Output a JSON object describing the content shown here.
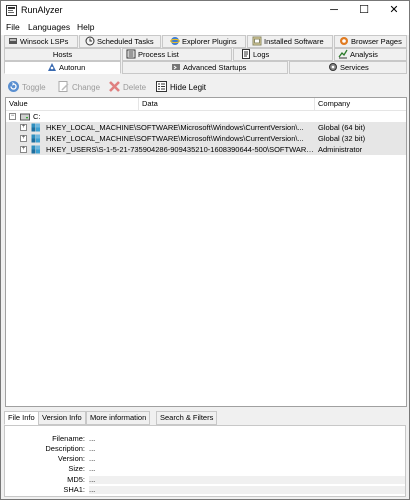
{
  "window": {
    "title": "RunAlyzer",
    "minimize": "─",
    "maximize": "☐",
    "close": "✕"
  },
  "menu": [
    "File",
    "Languages",
    "Help"
  ],
  "tabs_row1": [
    {
      "label": "Winsock LSPs",
      "icon": "winsock-icon"
    },
    {
      "label": "Scheduled Tasks",
      "icon": "clock-icon"
    },
    {
      "label": "Explorer Plugins",
      "icon": "explorer-icon"
    },
    {
      "label": "Installed Software",
      "icon": "software-icon"
    },
    {
      "label": "Browser Pages",
      "icon": "browser-icon"
    }
  ],
  "tabs_row2": [
    {
      "label": "Hosts",
      "icon": ""
    },
    {
      "label": "Process List",
      "icon": "process-icon"
    },
    {
      "label": "Logs",
      "icon": "logs-icon"
    },
    {
      "label": "Analysis",
      "icon": "analysis-icon"
    }
  ],
  "tabs_row3": [
    {
      "label": "Autorun",
      "icon": "autorun-icon",
      "active": true
    },
    {
      "label": "Advanced Startups",
      "icon": "advanced-icon"
    },
    {
      "label": "Services",
      "icon": "services-icon"
    }
  ],
  "toolbar": {
    "toggle": "Toggle",
    "change": "Change",
    "delete": "Delete",
    "hide_legit": "Hide Legit"
  },
  "grid": {
    "columns": [
      "Value",
      "Data",
      "Company"
    ],
    "root": "C:",
    "rows": [
      {
        "value": "HKEY_LOCAL_MACHINE\\SOFTWARE\\Microsoft\\Windows\\CurrentVersion\\...",
        "data": "",
        "company": "Global (64 bit)"
      },
      {
        "value": "HKEY_LOCAL_MACHINE\\SOFTWARE\\Microsoft\\Windows\\CurrentVersion\\...",
        "data": "",
        "company": "Global (32 bit)"
      },
      {
        "value": "HKEY_USERS\\S-1-5-21-735904286-909435210-1608390644-500\\SOFTWARE\\...",
        "data": "",
        "company": "Administrator"
      }
    ]
  },
  "bottom_tabs": [
    "File Info",
    "Version Info",
    "More information",
    "Search & Filters"
  ],
  "file_info": [
    {
      "label": "Filename:",
      "value": "..."
    },
    {
      "label": "Description:",
      "value": "..."
    },
    {
      "label": "Version:",
      "value": "..."
    },
    {
      "label": "Size:",
      "value": "..."
    },
    {
      "label": "MD5:",
      "value": "..."
    },
    {
      "label": "SHA1:",
      "value": "..."
    }
  ]
}
